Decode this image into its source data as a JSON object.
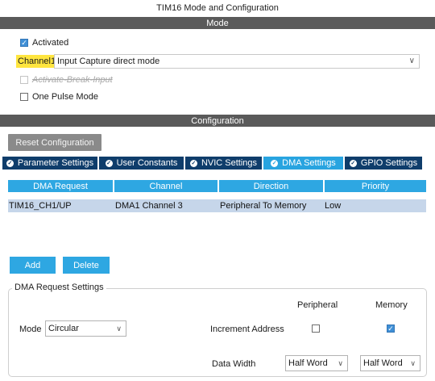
{
  "window": {
    "title": "TIM16 Mode and Configuration"
  },
  "mode": {
    "section_title": "Mode",
    "activated": {
      "label": "Activated",
      "checked": true
    },
    "channel": {
      "label": "Channel1",
      "value": "Input Capture direct mode"
    },
    "activate_break_input": {
      "label": "Activate-Break-Input",
      "checked": false,
      "disabled": true
    },
    "one_pulse_mode": {
      "label": "One Pulse Mode",
      "checked": false
    }
  },
  "configuration": {
    "section_title": "Configuration",
    "reset_label": "Reset Configuration",
    "tabs": [
      {
        "label": "Parameter Settings",
        "active": false
      },
      {
        "label": "User Constants",
        "active": false
      },
      {
        "label": "NVIC Settings",
        "active": false
      },
      {
        "label": "DMA Settings",
        "active": true
      },
      {
        "label": "GPIO Settings",
        "active": false
      }
    ],
    "table": {
      "headers": [
        "DMA Request",
        "Channel",
        "Direction",
        "Priority"
      ],
      "rows": [
        [
          "TIM16_CH1/UP",
          "DMA1 Channel 3",
          "Peripheral To Memory",
          "Low"
        ]
      ]
    },
    "add_label": "Add",
    "delete_label": "Delete",
    "dma_settings": {
      "title": "DMA Request Settings",
      "peripheral_label": "Peripheral",
      "memory_label": "Memory",
      "mode_label": "Mode",
      "mode_value": "Circular",
      "increment_label": "Increment Address",
      "increment_peripheral": false,
      "increment_memory": true,
      "data_width_label": "Data Width",
      "data_width_peripheral": "Half Word",
      "data_width_memory": "Half Word"
    }
  },
  "colors": {
    "section_bar": "#5a5a5a",
    "tab_inactive": "#0f3d6b",
    "tab_active": "#28a4e0",
    "table_header": "#2ea7e2",
    "selected_row": "#c6d6ea",
    "channel_highlight": "#ffe53f"
  },
  "icons": {
    "checkbox_check": "check-icon",
    "tab_icon": "check-circle-icon",
    "dropdown": "chevron-down-icon"
  }
}
